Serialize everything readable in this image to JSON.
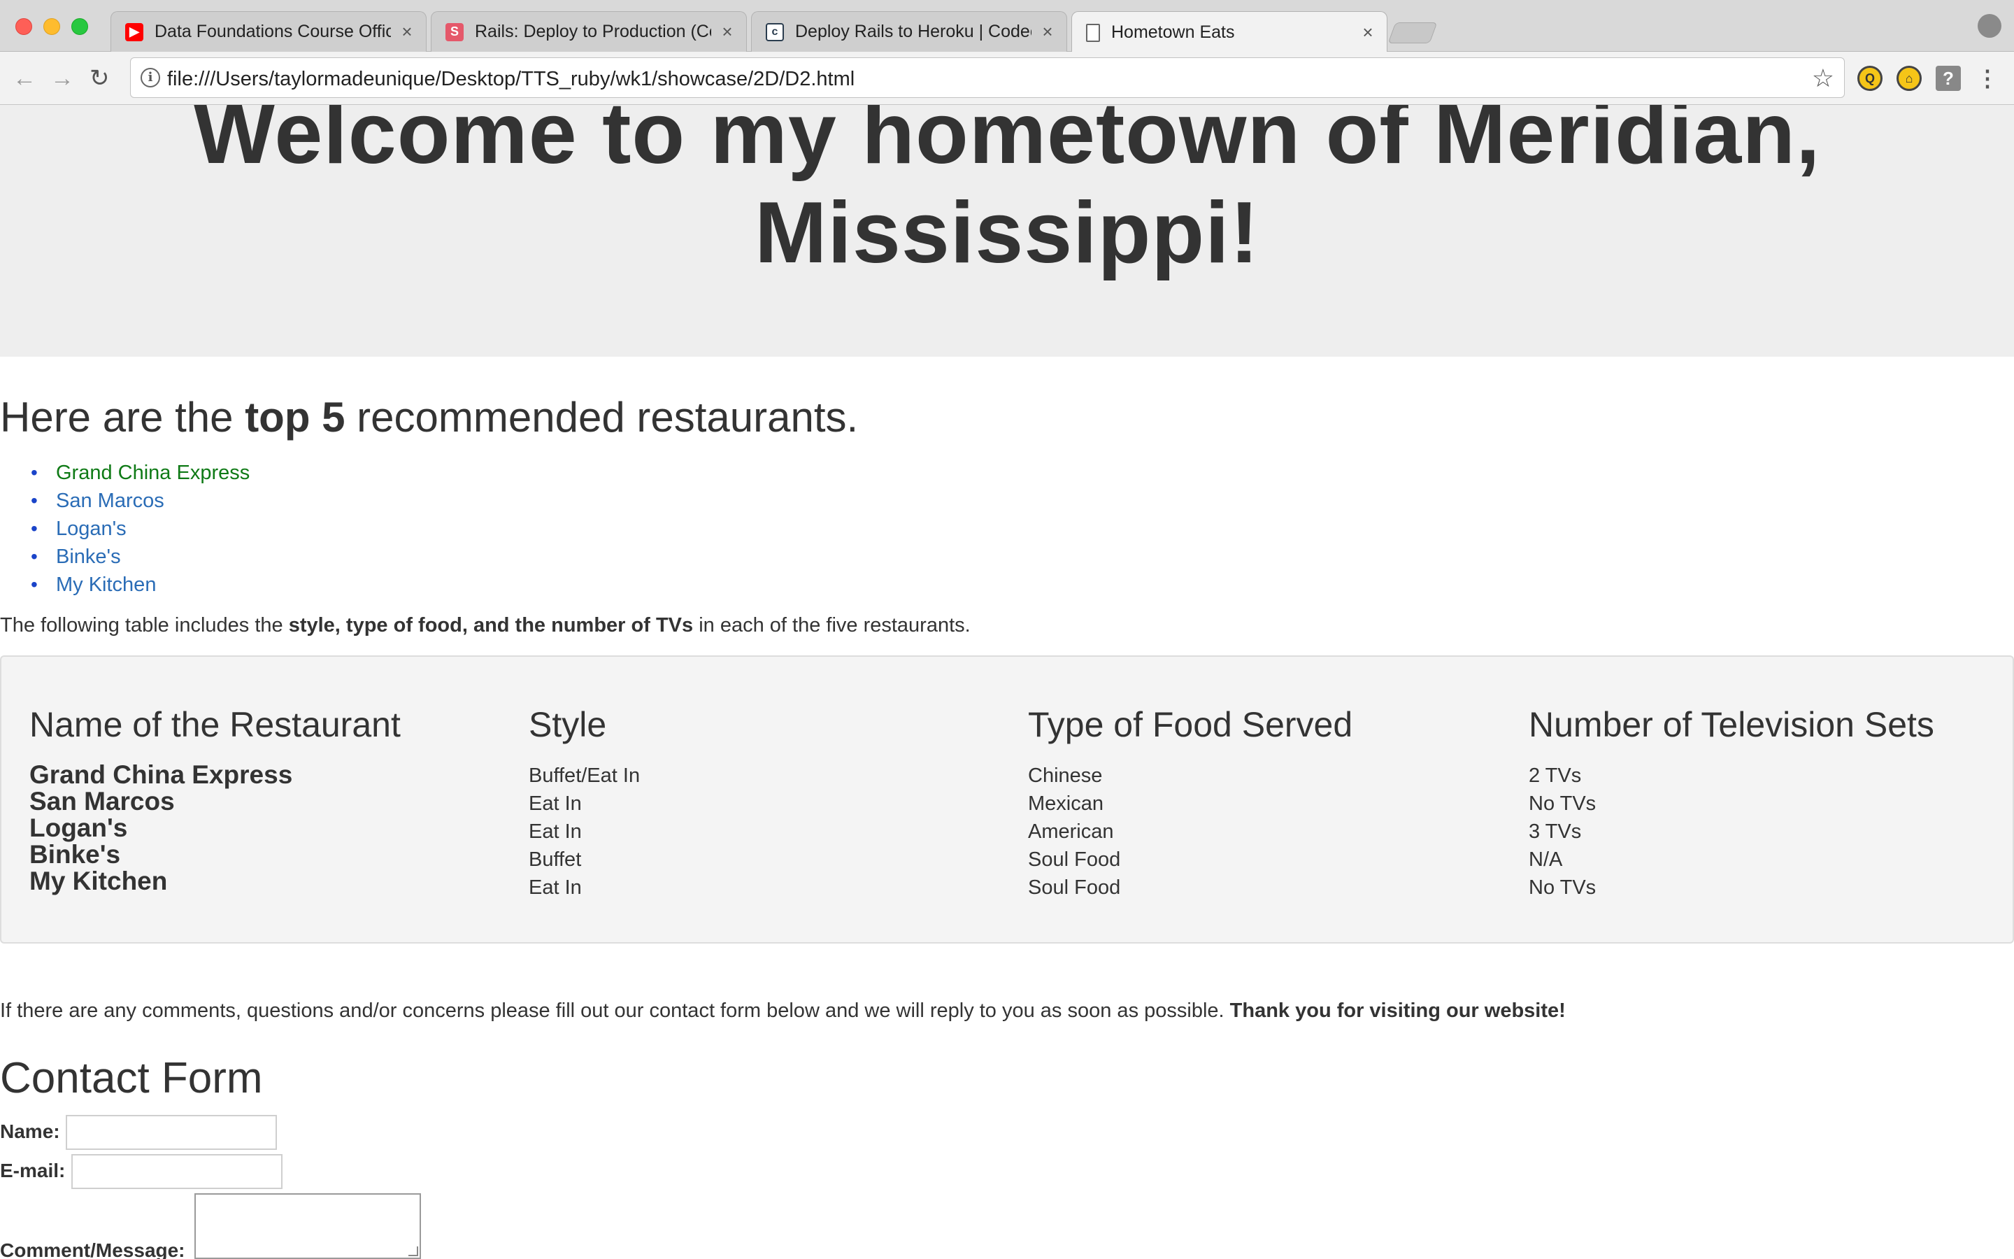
{
  "browser": {
    "tabs": [
      {
        "title": "Data Foundations Course Offic",
        "icon": "youtube-icon",
        "color": "#ff0000",
        "active": false
      },
      {
        "title": "Rails: Deploy to Production (Co",
        "icon": "s-icon",
        "color": "#e5586a",
        "active": false
      },
      {
        "title": "Deploy Rails to Heroku | Codec",
        "icon": "codecademy-icon",
        "color": "#2b3d4f",
        "active": false
      },
      {
        "title": "Hometown Eats",
        "icon": "page-icon",
        "color": "#666666",
        "active": true
      }
    ],
    "url": "file:///Users/taylormadeunique/Desktop/TTS_ruby/wk1/showcase/2D/D2.html"
  },
  "hero": {
    "title": "Welcome to my hometown of Meridian, Mississippi!"
  },
  "recommend": {
    "prefix": "Here are the ",
    "bold": "top 5",
    "suffix": " recommended restaurants.",
    "items": [
      "Grand China Express",
      "San Marcos",
      "Logan's",
      "Binke's",
      "My Kitchen"
    ]
  },
  "intro": {
    "prefix": "The following table includes the ",
    "bold": "style, type of food, and the number of TVs",
    "suffix": " in each of the five restaurants."
  },
  "table": {
    "headers": [
      "Name of the Restaurant",
      "Style",
      "Type of Food Served",
      "Number of Television Sets"
    ],
    "names": [
      "Grand China Express",
      "San Marcos",
      "Logan's",
      "Binke's",
      "My Kitchen"
    ],
    "styles": [
      "Buffet/Eat In",
      "Eat In",
      "Eat In",
      "Buffet",
      "Eat In"
    ],
    "foods": [
      "Chinese",
      "Mexican",
      "American",
      "Soul Food",
      "Soul Food"
    ],
    "tvs": [
      "2 TVs",
      "No TVs",
      "3 TVs",
      "N/A",
      "No TVs"
    ]
  },
  "comments": {
    "text": "If there are any comments, questions and/or concerns please fill out our contact form below and we will reply to you as soon as possible. ",
    "bold": "Thank you for visiting our website!"
  },
  "form": {
    "title": "Contact Form",
    "name_label": "Name:",
    "email_label": "E-mail:",
    "message_label": "Comment/Message:",
    "name_value": "",
    "email_value": "",
    "message_value": ""
  }
}
